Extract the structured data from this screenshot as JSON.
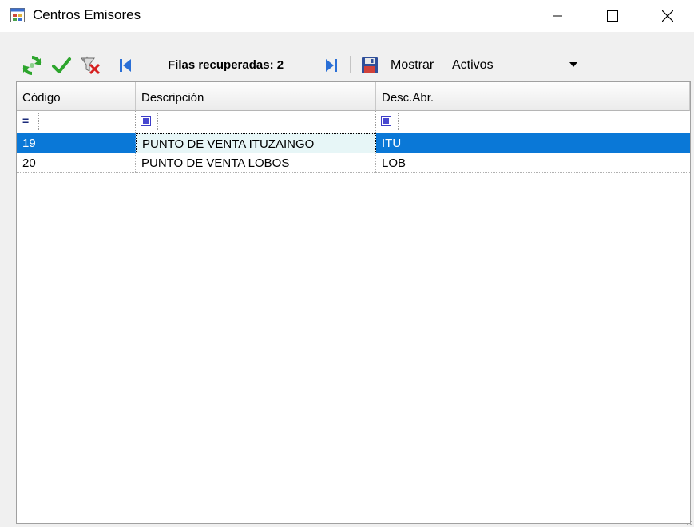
{
  "window": {
    "title": "Centros Emisores",
    "controls": {
      "minimize": "minimize-icon",
      "maximize": "maximize-icon",
      "close": "close-icon"
    }
  },
  "toolbar": {
    "icons": [
      "refresh-icon",
      "confirm-check-icon",
      "delete-filter-icon",
      "first-record-icon",
      "last-record-icon",
      "save-icon"
    ],
    "rows_label": "Filas recuperadas: 2",
    "show_label": "Mostrar",
    "show_value": "Activos"
  },
  "grid": {
    "columns": [
      "Código",
      "Descripción",
      "Desc.Abr."
    ],
    "filter_row": {
      "codigo_operator": "="
    },
    "rows": [
      {
        "codigo": "19",
        "descripcion": "PUNTO DE VENTA ITUZAINGO",
        "desc_abr": "ITU",
        "selected": true
      },
      {
        "codigo": "20",
        "descripcion": "PUNTO DE VENTA LOBOS",
        "desc_abr": "LOB",
        "selected": false
      }
    ]
  },
  "colors": {
    "selection": "#0a78d7",
    "focused_cell": "#e7f6f7",
    "accept_green": "#2da52d",
    "nav_blue": "#2a6fd6"
  }
}
